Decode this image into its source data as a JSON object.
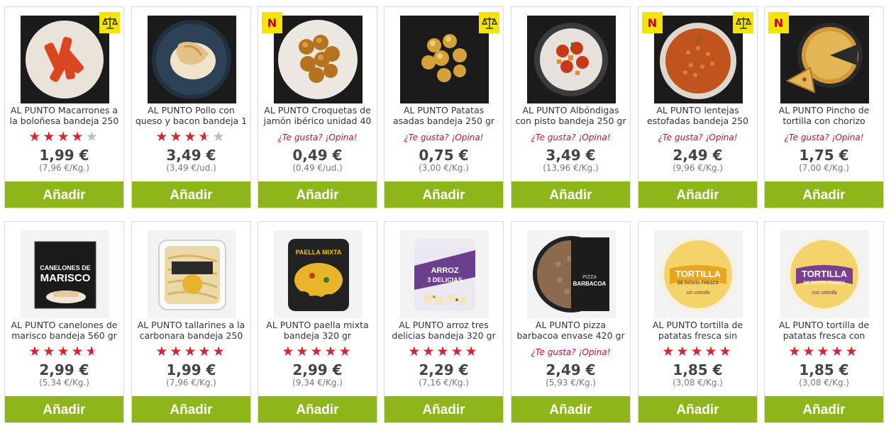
{
  "products": [
    {
      "name": "AL PUNTO Macarrones a la boloñesa bandeja 250",
      "price": "1,99 €",
      "unit_price": "(7,96 €/Kg.)",
      "rating": 4,
      "badge": "scale",
      "add_label": "Añadir",
      "image_icon": "pasta-bolognese"
    },
    {
      "name": "AL PUNTO Pollo con queso y bacon bandeja 1",
      "price": "3,49 €",
      "unit_price": "(3,49 €/ud.)",
      "rating": 3.5,
      "badge": "",
      "add_label": "Añadir",
      "image_icon": "chicken-cheese"
    },
    {
      "name": "AL PUNTO Croquetas de jamón ibérico unidad 40",
      "price": "0,49 €",
      "unit_price": "(0,49 €/ud.)",
      "opina": "¿Te gusta? ¡Opina!",
      "badge": "N",
      "add_label": "Añadir",
      "image_icon": "croquettes"
    },
    {
      "name": "AL PUNTO Patatas asadas bandeja 250 gr",
      "price": "0,75 €",
      "unit_price": "(3,00 €/Kg.)",
      "opina": "¿Te gusta? ¡Opina!",
      "badge": "scale",
      "add_label": "Añadir",
      "image_icon": "roast-potatoes"
    },
    {
      "name": "AL PUNTO Albóndigas con pisto bandeja 250 gr",
      "price": "3,49 €",
      "unit_price": "(13,96 €/Kg.)",
      "opina": "¿Te gusta? ¡Opina!",
      "badge": "",
      "add_label": "Añadir",
      "image_icon": "meatballs"
    },
    {
      "name": "AL PUNTO lentejas estofadas bandeja 250",
      "price": "2,49 €",
      "unit_price": "(9,96 €/Kg.)",
      "opina": "¿Te gusta? ¡Opina!",
      "badge": "N+scale",
      "add_label": "Añadir",
      "image_icon": "lentil-stew"
    },
    {
      "name": "AL PUNTO Pincho de tortilla con chorizo",
      "price": "1,75 €",
      "unit_price": "(7,00 €/Kg.)",
      "opina": "¿Te gusta? ¡Opina!",
      "badge": "N",
      "add_label": "Añadir",
      "image_icon": "tortilla-chorizo"
    },
    {
      "name": "AL PUNTO canelones de marisco bandeja 560 gr",
      "price": "2,99 €",
      "unit_price": "(5,34 €/Kg.)",
      "rating": 4.5,
      "badge": "",
      "add_label": "Añadir",
      "image_icon": "cannelloni-box",
      "package_text": [
        "CANELONES DE",
        "MARISCO"
      ]
    },
    {
      "name": "AL PUNTO tallarines a la carbonara bandeja 250",
      "price": "1,99 €",
      "unit_price": "(7,96 €/Kg.)",
      "rating": 5,
      "badge": "",
      "add_label": "Añadir",
      "image_icon": "carbonara-tray"
    },
    {
      "name": "AL PUNTO paella mixta bandeja 320 gr",
      "price": "2,99 €",
      "unit_price": "(9,34 €/Kg.)",
      "rating": 5,
      "badge": "",
      "add_label": "Añadir",
      "image_icon": "paella-tray",
      "package_text": [
        "PAELLA MIXTA"
      ]
    },
    {
      "name": "AL PUNTO arroz tres delicias bandeja 320 gr",
      "price": "2,29 €",
      "unit_price": "(7,16 €/Kg.)",
      "rating": 5,
      "badge": "",
      "add_label": "Añadir",
      "image_icon": "rice-tray",
      "package_text": [
        "ARROZ",
        "3 DELICIAS"
      ]
    },
    {
      "name": "AL PUNTO pizza barbacoa envase 420 gr",
      "price": "2,49 €",
      "unit_price": "(5,93 €/Kg.)",
      "opina": "¿Te gusta? ¡Opina!",
      "badge": "",
      "add_label": "Añadir",
      "image_icon": "pizza-box",
      "package_text": [
        "PIZZA",
        "BARBACOA"
      ]
    },
    {
      "name": "AL PUNTO tortilla de patatas fresca sin",
      "price": "1,85 €",
      "unit_price": "(3,08 €/Kg.)",
      "rating": 5,
      "badge": "",
      "add_label": "Añadir",
      "image_icon": "tortilla-pack-yellow",
      "package_text": [
        "TORTILLA",
        "DE PATATA FRESCA",
        "sin cebolla"
      ]
    },
    {
      "name": "AL PUNTO tortilla de patatas fresca con",
      "price": "1,85 €",
      "unit_price": "(3,08 €/Kg.)",
      "rating": 5,
      "badge": "",
      "add_label": "Añadir",
      "image_icon": "tortilla-pack-purple",
      "package_text": [
        "TORTILLA",
        "DE PATATA FRESCA",
        "con cebolla"
      ]
    }
  ],
  "colors": {
    "accent": "#8eb51a",
    "star": "#d8242d",
    "badge": "#f3e500",
    "opina": "#c8102e"
  }
}
